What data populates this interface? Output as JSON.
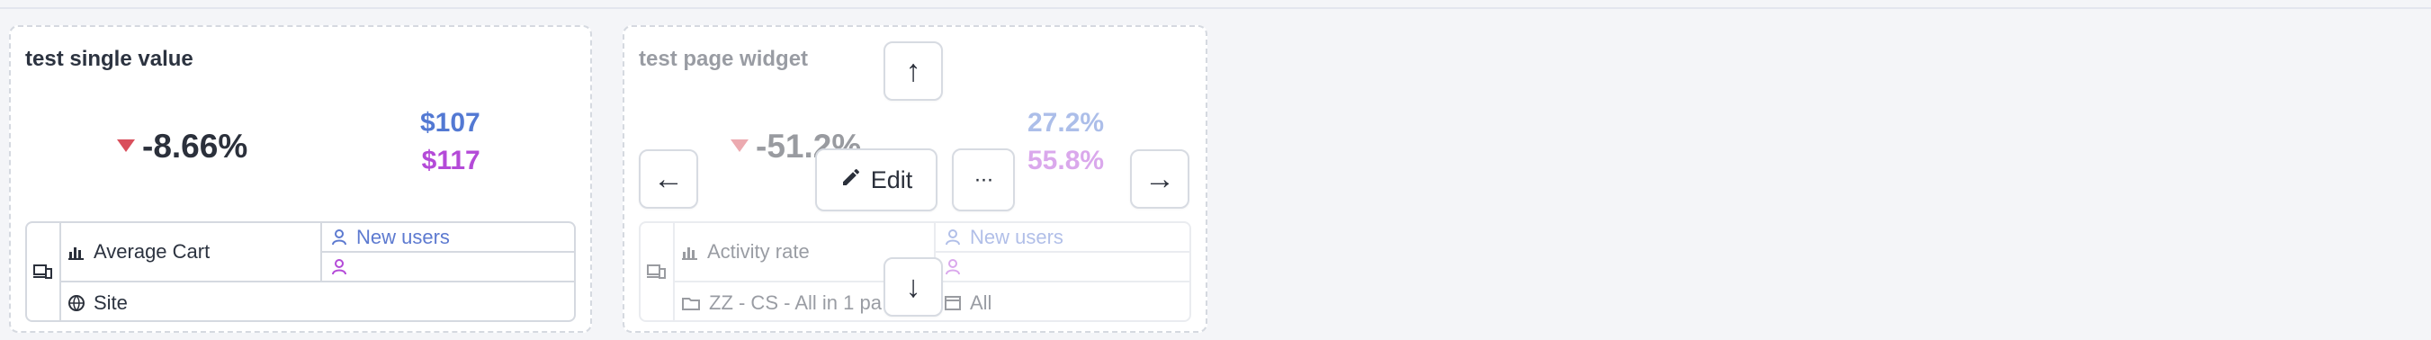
{
  "widgets": [
    {
      "title": "test single value",
      "main_value": "-8.66%",
      "right_values": [
        "$107",
        "$117"
      ],
      "metric": "Average Cart",
      "scope": "Site",
      "segment_1": "New users",
      "segment_2": "",
      "colors": {
        "trend_down": "#d94f5c",
        "series_1": "#5379d3",
        "series_2": "#b44ad8"
      },
      "icons": {
        "left_column": "devices-icon",
        "metric": "bar-chart-icon",
        "scope": "globe-icon",
        "segment": "user-icon",
        "trend": "down-triangle-icon"
      }
    },
    {
      "title": "test page widget",
      "main_value": "-51.2%",
      "right_values": [
        "27.2%",
        "55.8%"
      ],
      "metric": "Activity rate",
      "scope": "ZZ - CS - All in 1 pa",
      "segment_1": "New users",
      "segment_2": "",
      "filter": "All",
      "colors": {
        "trend_down": "#d94f5c",
        "series_1": "#5379d3",
        "series_2": "#b44ad8"
      },
      "icons": {
        "left_column": "devices-icon",
        "metric": "bar-chart-icon",
        "scope": "folder-icon",
        "segment": "user-icon",
        "filter": "window-icon",
        "trend": "down-triangle-icon"
      }
    }
  ],
  "controls": {
    "edit_label": "Edit",
    "more_label": "···",
    "arrow_up": "↑",
    "arrow_down": "↓",
    "arrow_left": "←",
    "arrow_right": "→"
  }
}
